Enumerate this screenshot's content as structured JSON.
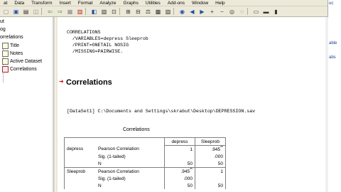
{
  "menu": [
    "at",
    "Data",
    "Transform",
    "Insert",
    "Format",
    "Analyze",
    "Graphs",
    "Utilities",
    "Add-ons",
    "Window",
    "Help"
  ],
  "right_strip": {
    "l1": "uc",
    "l2": "",
    "l3": "able",
    "l4": "abs"
  },
  "outline": {
    "items": [
      {
        "label": "ut",
        "indent": 0,
        "icon": false
      },
      {
        "label": "og",
        "indent": 0,
        "icon": false
      },
      {
        "label": "orrelations",
        "indent": 0,
        "icon": false
      },
      {
        "label": "Title",
        "indent": 2,
        "icon": true
      },
      {
        "label": "Notes",
        "indent": 2,
        "icon": true
      },
      {
        "label": "Active Dataset",
        "indent": 2,
        "icon": true
      },
      {
        "label": "Correlations",
        "indent": 2,
        "icon": true
      }
    ]
  },
  "syntax": "CORRELATIONS\n  /VARIABLES=depress Sleeprob\n  /PRINT=ONETAIL NOSIG\n  /MISSING=PAIRWISE.",
  "heading": "Correlations",
  "dataset": "[DataSet1] C:\\Documents and Settings\\skrabut\\Desktop\\DEPRESSION.sav",
  "table": {
    "title": "Correlations",
    "col_headers": [
      "depress",
      "Sleeprob"
    ],
    "rows": [
      {
        "var": "depress",
        "stat": "Pearson Correlation",
        "v1": "1",
        "v2": ".945",
        "v2sup": "**"
      },
      {
        "var": "",
        "stat": "Sig. (1-tailed)",
        "v1": "",
        "v2": ".000",
        "v2sup": ""
      },
      {
        "var": "",
        "stat": "N",
        "v1": "50",
        "v2": "50",
        "v2sup": ""
      },
      {
        "var": "Sleeprob",
        "stat": "Pearson Correlation",
        "v1": ".945",
        "v1sup": "**",
        "v2": "1",
        "v2sup": ""
      },
      {
        "var": "",
        "stat": "Sig. (1-tailed)",
        "v1": ".000",
        "v2": "",
        "v2sup": ""
      },
      {
        "var": "",
        "stat": "N",
        "v1": "50",
        "v2": "50",
        "v2sup": ""
      }
    ]
  }
}
